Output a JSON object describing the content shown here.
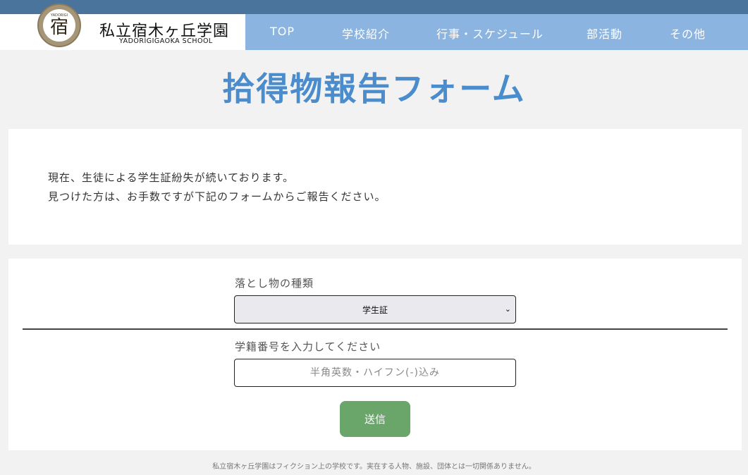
{
  "header": {
    "emblem_text": "YADORIGI",
    "emblem_kanji": "宿",
    "school_name": "私立宿木ヶ丘学園",
    "school_name_roman": "YADORIGIGAOKA SCHOOL"
  },
  "nav": {
    "items": [
      {
        "label": "TOP"
      },
      {
        "label": "学校紹介"
      },
      {
        "label": "行事・スケジュール"
      },
      {
        "label": "部活動"
      },
      {
        "label": "その他"
      }
    ]
  },
  "page": {
    "title": "拾得物報告フォーム"
  },
  "notice": {
    "line1": "現在、生徒による学生証紛失が続いております。",
    "line2": "見つけた方は、お手数ですが下記のフォームからご報告ください。"
  },
  "form": {
    "item_type_label": "落とし物の種類",
    "item_type_selected": "学生証",
    "student_id_label": "学籍番号を入力してください",
    "student_id_value": "",
    "student_id_placeholder": "半角英数・ハイフン(-)込み",
    "submit_label": "送信"
  },
  "footer": {
    "disclaimer": "私立宿木ヶ丘学園はフィクション上の学校です。実在する人物、施設、団体とは一切関係ありません。"
  },
  "icons": {
    "select_arrow": "chevron-down-icon"
  },
  "colors": {
    "topbar": "#4a749c",
    "nav_bg": "#8cb4e0",
    "title": "#4a8ccc",
    "submit_bg": "#6aa56a"
  }
}
